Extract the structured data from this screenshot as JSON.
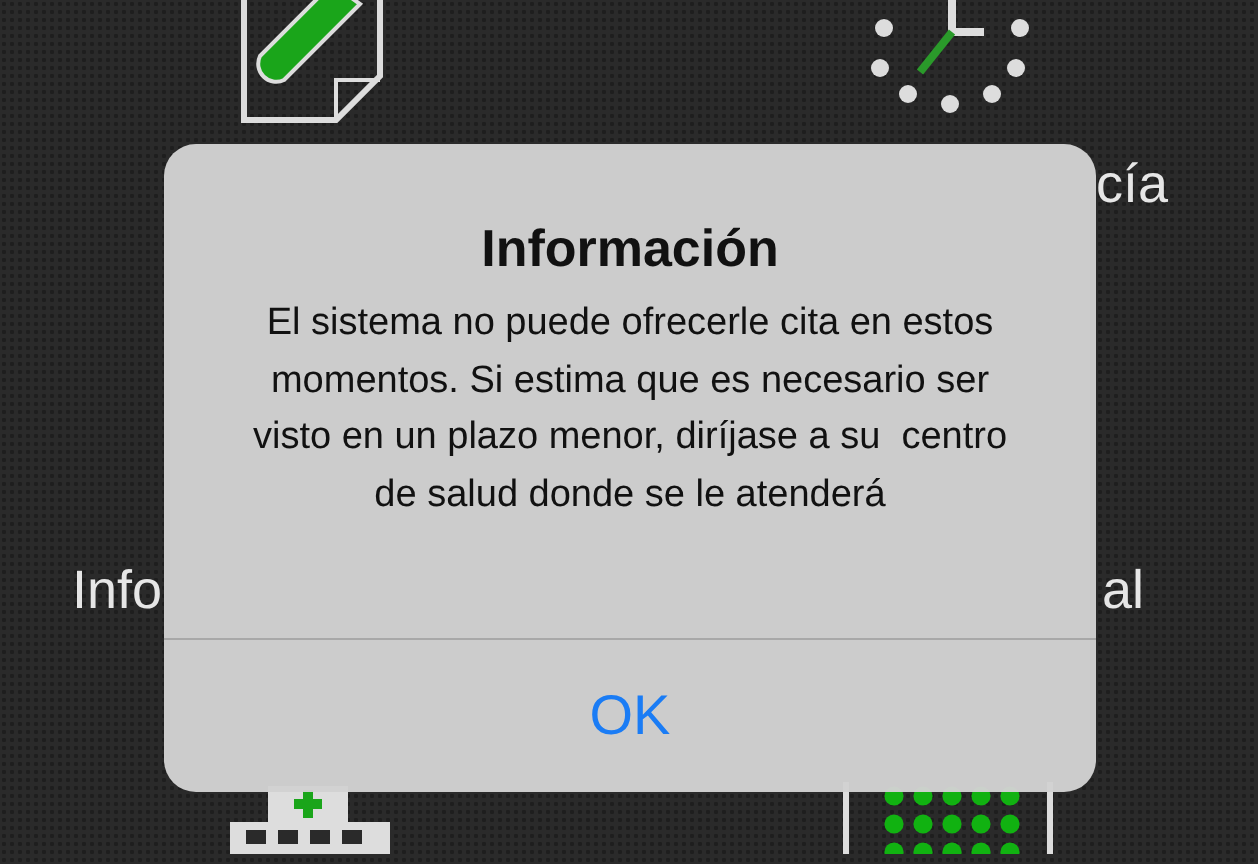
{
  "home_labels": {
    "top_right": "cía",
    "middle_left": "Info",
    "middle_right": "al"
  },
  "alert": {
    "title": "Información",
    "message": "El sistema no puede ofrecerle cita en estos momentos. Si estima que es necesario ser visto en un plazo menor, diríjase a su  centro de salud donde se le atenderá",
    "buttons": [
      "OK"
    ]
  }
}
